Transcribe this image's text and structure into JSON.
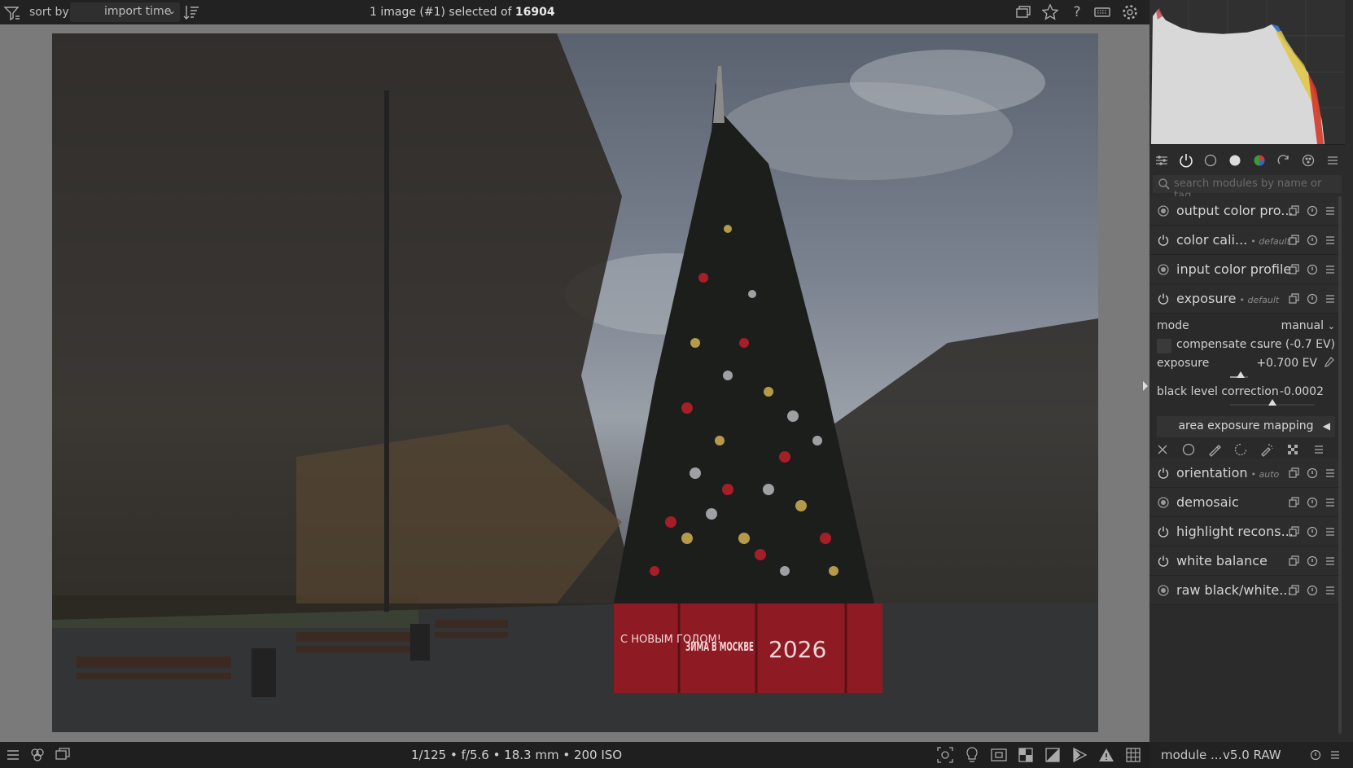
{
  "topbar": {
    "sort_label": "sort by",
    "sort_value": "import time",
    "status_prefix": "1 image (#1) selected of",
    "status_total": "16904",
    "icons": [
      "filter-icon",
      "sort-order-icon",
      "grouping-icon",
      "star-icon",
      "help-icon",
      "keyboard-icon",
      "gear-icon"
    ]
  },
  "photo": {
    "banner_text_1": "С НОВЫМ ГОДОМ!",
    "banner_text_2": "ЗИМА В МОСКВЕ",
    "banner_text_3": "2026"
  },
  "bottombar": {
    "exif": "1/125 • f/5.6 • 18.3 mm • 200 ISO",
    "left_icons": [
      "hamburger-icon",
      "styles-icon",
      "second-window-icon"
    ],
    "right_icons": [
      "focus-peaking-icon",
      "color-assessment-icon",
      "raw-overexposed-icon",
      "clipping-icon",
      "softproof-icon",
      "gamut-check-icon",
      "warning-icon",
      "guides-icon"
    ]
  },
  "rightpanel": {
    "search_placeholder": "search modules by name or tag",
    "modules_top": [
      {
        "name": "output color pro...",
        "tag": "",
        "power": "locked"
      },
      {
        "name": "color cali...",
        "tag": "• default",
        "power": "on"
      },
      {
        "name": "input color profile",
        "tag": "",
        "power": "locked"
      },
      {
        "name": "exposure",
        "tag": "• default",
        "power": "on"
      }
    ],
    "exposure": {
      "mode_label": "mode",
      "mode_value": "manual",
      "compensate_label": "compensate c...",
      "compensate_value": "sure (-0.7 EV)",
      "exposure_label": "exposure",
      "exposure_value": "+0.700 EV",
      "exposure_level": 0.58,
      "black_label": "black level correction",
      "black_value": "-0.0002",
      "black_level": 0.5,
      "area_mapping_label": "area exposure mapping"
    },
    "modules_bottom": [
      {
        "name": "orientation",
        "tag": "• auto",
        "power": "on"
      },
      {
        "name": "demosaic",
        "tag": "",
        "power": "locked"
      },
      {
        "name": "highlight recons...",
        "tag": "",
        "power": "on"
      },
      {
        "name": "white balance",
        "tag": "",
        "power": "on"
      },
      {
        "name": "raw black/white...",
        "tag": "",
        "power": "locked"
      }
    ],
    "footer_label": "module ...",
    "footer_version": "v5.0 RAW"
  }
}
